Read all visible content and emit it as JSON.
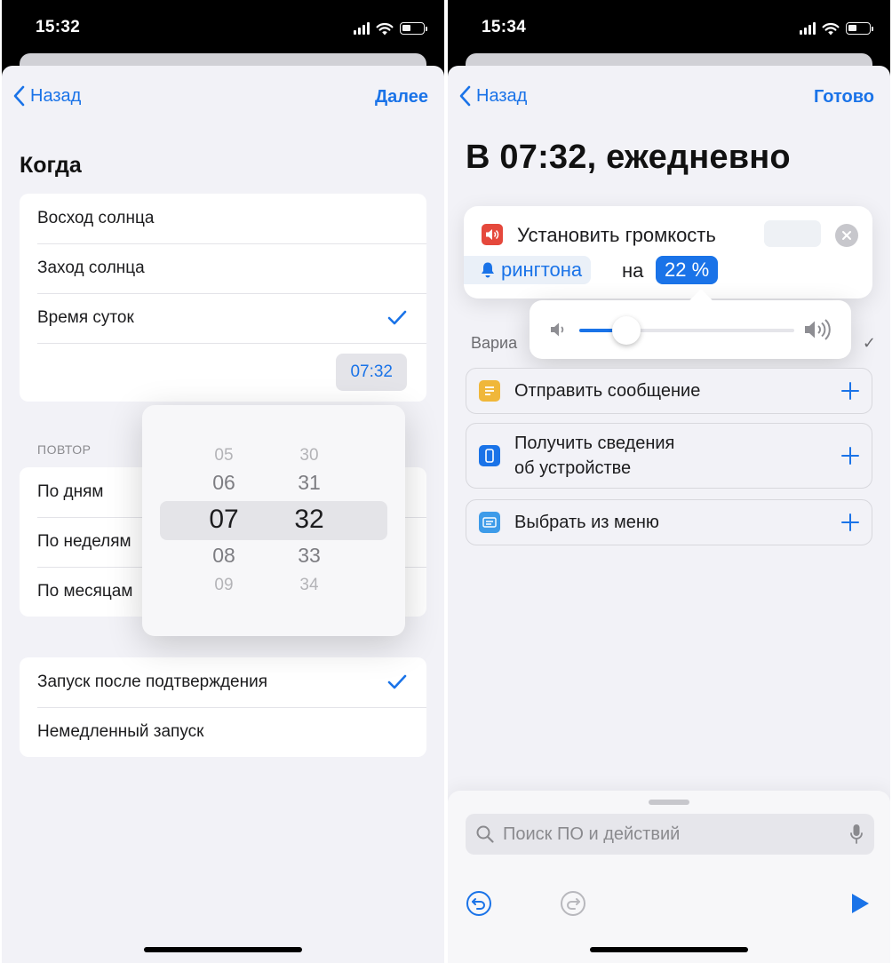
{
  "left": {
    "status": {
      "time": "15:32"
    },
    "nav": {
      "back": "Назад",
      "next": "Далее"
    },
    "when": {
      "title": "Когда",
      "options": [
        {
          "label": "Восход солнца",
          "checked": false
        },
        {
          "label": "Заход солнца",
          "checked": false
        },
        {
          "label": "Время суток",
          "checked": true
        }
      ],
      "time_value": "07:32"
    },
    "repeat": {
      "caption": "ПОВТОР",
      "options": [
        "По дням",
        "По неделям",
        "По месяцам"
      ]
    },
    "picker": {
      "hours": [
        "05",
        "06",
        "07",
        "08",
        "09"
      ],
      "minutes": [
        "30",
        "31",
        "32",
        "33",
        "34"
      ],
      "selected_hour": "07",
      "selected_minute": "32"
    },
    "run": {
      "options": [
        {
          "label": "Запуск после подтверждения",
          "checked": true
        },
        {
          "label": "Немедленный запуск",
          "checked": false
        }
      ]
    }
  },
  "right": {
    "status": {
      "time": "15:34"
    },
    "nav": {
      "back": "Назад",
      "done": "Готово"
    },
    "title": "В 07:32, ежедневно",
    "action": {
      "title": "Установить громкость",
      "ringtone": "рингтона",
      "on_word": "на",
      "percent_text": "22 %",
      "volume_level": 0.22
    },
    "variables_label": "Вариа",
    "suggestions": [
      {
        "label": "Отправить сообщение",
        "icon": "note-icon",
        "color": "#f0b73a"
      },
      {
        "label": "Получить сведения\nоб устройстве",
        "icon": "device-icon",
        "color": "#1a73e8"
      },
      {
        "label": "Выбрать из меню",
        "icon": "menu-icon",
        "color": "#3d9be9"
      }
    ],
    "search": {
      "placeholder": "Поиск ПО и действий"
    }
  },
  "colors": {
    "accent": "#1a73e8",
    "speaker_red": "#e5483c"
  }
}
